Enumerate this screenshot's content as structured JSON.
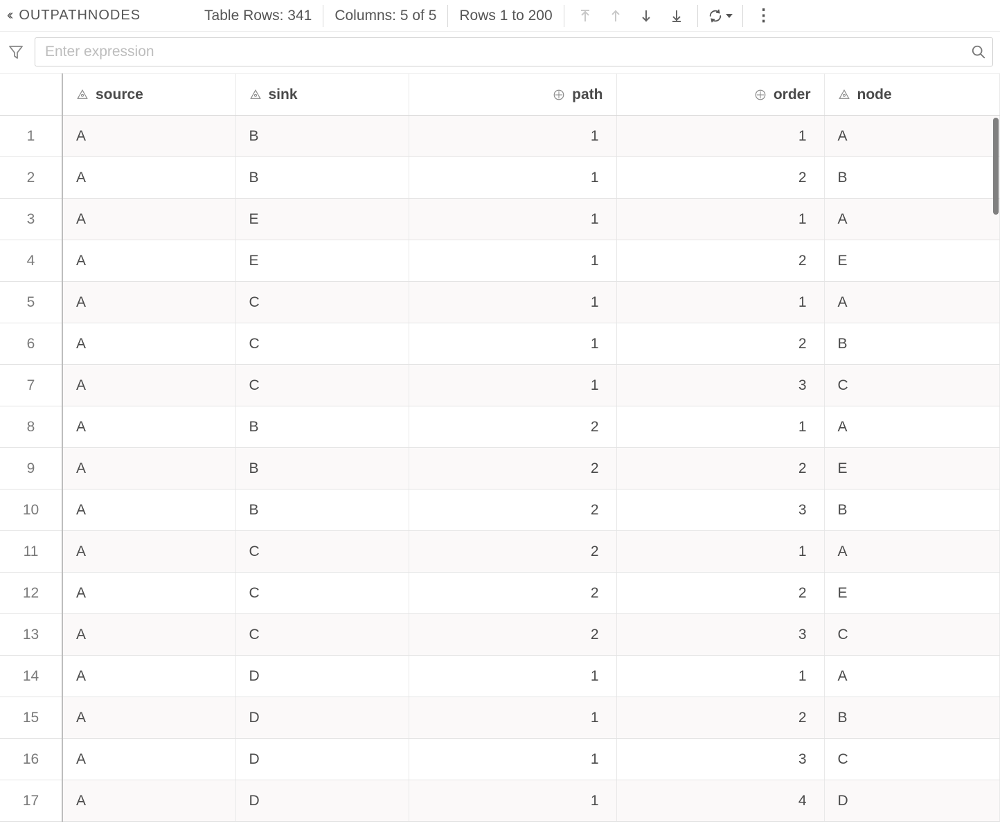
{
  "toolbar": {
    "title": "OUTPATHNODES",
    "rows_label": "Table Rows: 341",
    "columns_label": "Columns: 5 of 5",
    "range_label": "Rows 1 to 200"
  },
  "filter": {
    "placeholder": "Enter expression"
  },
  "columns": [
    {
      "key": "source",
      "label": "source",
      "type": "char",
      "align": "left"
    },
    {
      "key": "sink",
      "label": "sink",
      "type": "char",
      "align": "left"
    },
    {
      "key": "path",
      "label": "path",
      "type": "num",
      "align": "right"
    },
    {
      "key": "order",
      "label": "order",
      "type": "num",
      "align": "right"
    },
    {
      "key": "node",
      "label": "node",
      "type": "char",
      "align": "left"
    }
  ],
  "rows": [
    {
      "n": 1,
      "source": "A",
      "sink": "B",
      "path": 1,
      "order": 1,
      "node": "A"
    },
    {
      "n": 2,
      "source": "A",
      "sink": "B",
      "path": 1,
      "order": 2,
      "node": "B"
    },
    {
      "n": 3,
      "source": "A",
      "sink": "E",
      "path": 1,
      "order": 1,
      "node": "A"
    },
    {
      "n": 4,
      "source": "A",
      "sink": "E",
      "path": 1,
      "order": 2,
      "node": "E"
    },
    {
      "n": 5,
      "source": "A",
      "sink": "C",
      "path": 1,
      "order": 1,
      "node": "A"
    },
    {
      "n": 6,
      "source": "A",
      "sink": "C",
      "path": 1,
      "order": 2,
      "node": "B"
    },
    {
      "n": 7,
      "source": "A",
      "sink": "C",
      "path": 1,
      "order": 3,
      "node": "C"
    },
    {
      "n": 8,
      "source": "A",
      "sink": "B",
      "path": 2,
      "order": 1,
      "node": "A"
    },
    {
      "n": 9,
      "source": "A",
      "sink": "B",
      "path": 2,
      "order": 2,
      "node": "E"
    },
    {
      "n": 10,
      "source": "A",
      "sink": "B",
      "path": 2,
      "order": 3,
      "node": "B"
    },
    {
      "n": 11,
      "source": "A",
      "sink": "C",
      "path": 2,
      "order": 1,
      "node": "A"
    },
    {
      "n": 12,
      "source": "A",
      "sink": "C",
      "path": 2,
      "order": 2,
      "node": "E"
    },
    {
      "n": 13,
      "source": "A",
      "sink": "C",
      "path": 2,
      "order": 3,
      "node": "C"
    },
    {
      "n": 14,
      "source": "A",
      "sink": "D",
      "path": 1,
      "order": 1,
      "node": "A"
    },
    {
      "n": 15,
      "source": "A",
      "sink": "D",
      "path": 1,
      "order": 2,
      "node": "B"
    },
    {
      "n": 16,
      "source": "A",
      "sink": "D",
      "path": 1,
      "order": 3,
      "node": "C"
    },
    {
      "n": 17,
      "source": "A",
      "sink": "D",
      "path": 1,
      "order": 4,
      "node": "D"
    }
  ]
}
